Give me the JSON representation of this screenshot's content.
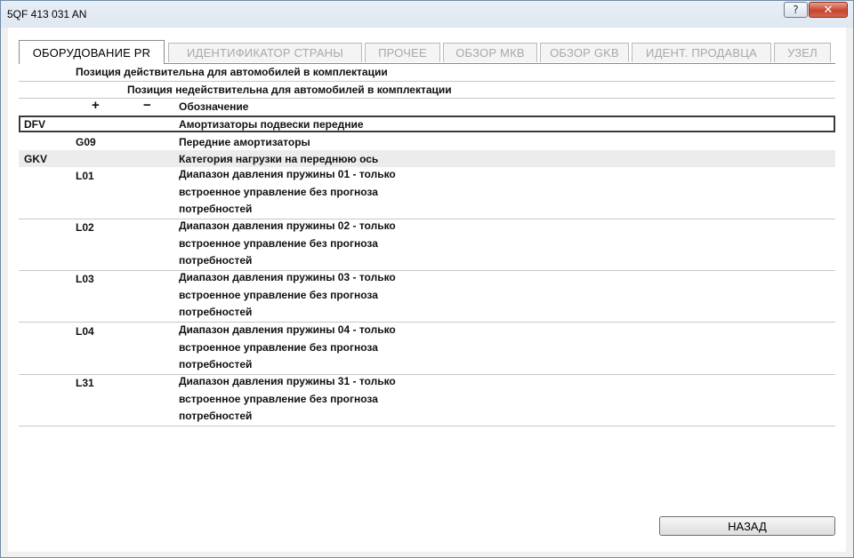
{
  "window": {
    "title": "5QF 413 031 AN",
    "help_label": "?",
    "close_label": "✕"
  },
  "tabs": [
    {
      "label": "ОБОРУДОВАНИЕ PR",
      "active": true
    },
    {
      "label": "ИДЕНТИФИКАТОР СТРАНЫ",
      "active": false
    },
    {
      "label": "ПРОЧЕЕ",
      "active": false
    },
    {
      "label": "ОБЗОР МКВ",
      "active": false
    },
    {
      "label": "ОБЗОР GKB",
      "active": false
    },
    {
      "label": "ИДЕНТ. ПРОДАВЦА",
      "active": false
    },
    {
      "label": "УЗЕЛ",
      "active": false
    }
  ],
  "header": {
    "valid_label": "Позиция действительна для автомобилей в комплектации",
    "invalid_label": "Позиция недействительна для автомобилей в комплектации",
    "plus_label": "+",
    "minus_label": "−",
    "designation_label": "Обозначение"
  },
  "rows": [
    {
      "family": "DFV",
      "code": "",
      "text": "Амортизаторы подвески передние"
    },
    {
      "family": "",
      "code": "G09",
      "text": "Передние амортизаторы"
    },
    {
      "family": "GKV",
      "code": "",
      "text": "Категория нагрузки на переднюю ось"
    },
    {
      "family": "",
      "code": "L01",
      "text": "Диапазон давления пружины 01 - только встроенное управление без прогноза потребностей"
    },
    {
      "family": "",
      "code": "L02",
      "text": "Диапазон давления пружины 02 - только встроенное управление без прогноза потребностей"
    },
    {
      "family": "",
      "code": "L03",
      "text": "Диапазон давления пружины 03 - только встроенное управление без прогноза потребностей"
    },
    {
      "family": "",
      "code": "L04",
      "text": "Диапазон давления пружины 04 - только встроенное управление без прогноза потребностей"
    },
    {
      "family": "",
      "code": "L31",
      "text": "Диапазон давления пружины 31 - только встроенное управление без прогноза потребностей"
    }
  ],
  "back_button": {
    "label_underlined": "Н",
    "label_rest": "АЗАД"
  }
}
